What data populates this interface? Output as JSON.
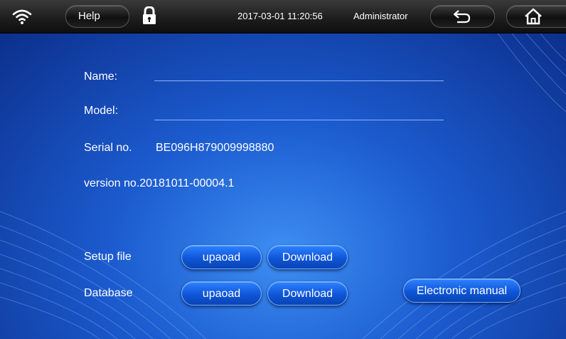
{
  "topbar": {
    "wifi_icon": "wifi-icon",
    "help_label": "Help",
    "lock_icon": "lock-icon",
    "datetime": "2017-03-01  11:20:56",
    "user": "Administrator",
    "back_icon": "back-arrow-icon",
    "home_icon": "home-icon"
  },
  "info": {
    "name_label": "Name:",
    "name_value": "",
    "model_label": "Model:",
    "model_value": "",
    "serial_label": "Serial no.",
    "serial_value": "BE096H879009998880",
    "version": "version no.20181011-00004.1"
  },
  "files": {
    "setup_label": "Setup file",
    "database_label": "Database",
    "upload_label": "upaoad",
    "download_label": "Download"
  },
  "manual_label": "Electronic manual",
  "colors": {
    "topbar": "#1c1c1c",
    "background": "#1c5cd0",
    "button": "#1760e0",
    "underline": "#8fb2ff"
  }
}
